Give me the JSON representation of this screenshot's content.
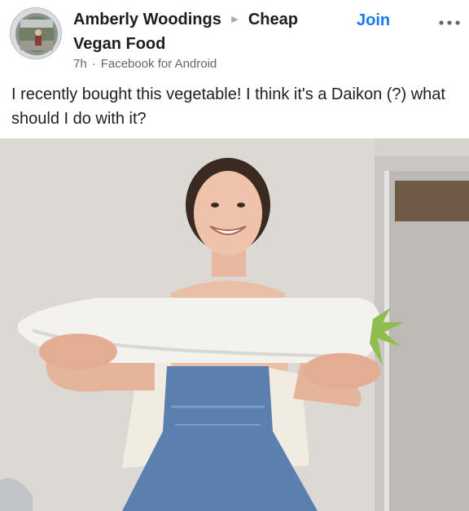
{
  "post": {
    "author": "Amberly Woodings",
    "group": "Cheap Vegan Food",
    "time": "7h",
    "source": "Facebook for Android",
    "join_label": "Join",
    "text": "I recently bought this vegetable! I think it's a Daikon (?) what should I do with it?"
  },
  "icons": {
    "avatar": "group-avatar",
    "more": "more-options-icon",
    "arrow": "triangle-right-icon"
  },
  "colors": {
    "accent": "#1877f2",
    "text": "#1c1e21",
    "meta": "#606770"
  }
}
